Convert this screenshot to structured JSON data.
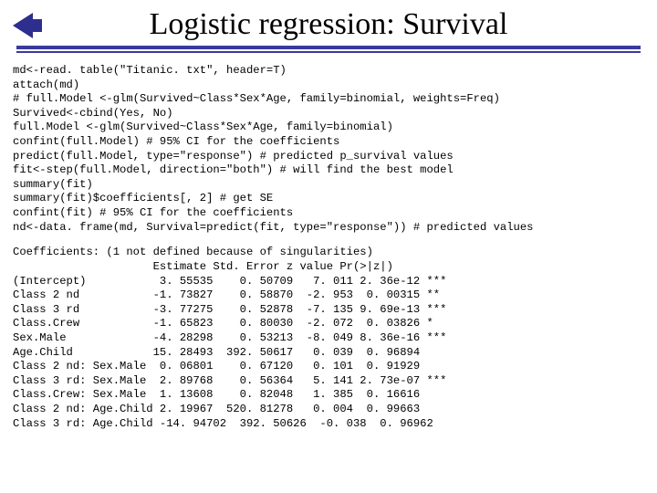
{
  "title": "Logistic regression: Survival",
  "code_lines": [
    "md<-read. table(\"Titanic. txt\", header=T)",
    "attach(md)",
    "# full.Model <-glm(Survived~Class*Sex*Age, family=binomial, weights=Freq)",
    "Survived<-cbind(Yes, No)",
    "full.Model <-glm(Survived~Class*Sex*Age, family=binomial)",
    "confint(full.Model) # 95% CI for the coefficients",
    "predict(full.Model, type=\"response\") # predicted p_survival values",
    "fit<-step(full.Model, direction=\"both\") # will find the best model",
    "summary(fit)",
    "summary(fit)$coefficients[, 2] # get SE",
    "confint(fit) # 95% CI for the coefficients",
    "nd<-data. frame(md, Survival=predict(fit, type=\"response\")) # predicted values"
  ],
  "coef_header": "Coefficients: (1 not defined because of singularities)",
  "coef_colhead": "                     Estimate Std. Error z value Pr(>|z|)",
  "coef_rows": [
    "(Intercept)           3. 55535    0. 50709   7. 011 2. 36e-12 ***",
    "Class 2 nd           -1. 73827    0. 58870  -2. 953  0. 00315 **",
    "Class 3 rd           -3. 77275    0. 52878  -7. 135 9. 69e-13 ***",
    "Class.Crew           -1. 65823    0. 80030  -2. 072  0. 03826 *",
    "Sex.Male             -4. 28298    0. 53213  -8. 049 8. 36e-16 ***",
    "Age.Child            15. 28493  392. 50617   0. 039  0. 96894",
    "Class 2 nd: Sex.Male  0. 06801    0. 67120   0. 101  0. 91929",
    "Class 3 rd: Sex.Male  2. 89768    0. 56364   5. 141 2. 73e-07 ***",
    "Class.Crew: Sex.Male  1. 13608    0. 82048   1. 385  0. 16616",
    "Class 2 nd: Age.Child 2. 19967  520. 81278   0. 004  0. 99663",
    "Class 3 rd: Age.Child -14. 94702  392. 50626  -0. 038  0. 96962"
  ]
}
